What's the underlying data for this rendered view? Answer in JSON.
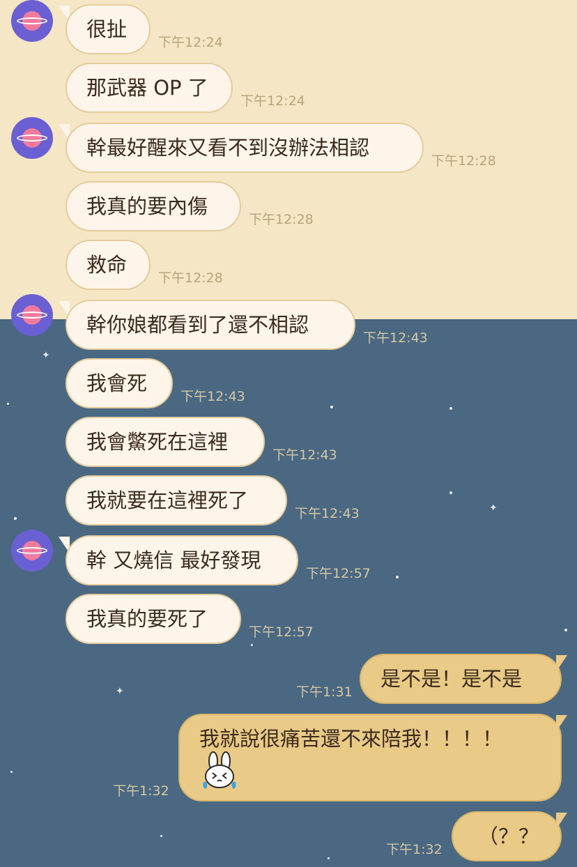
{
  "theme": {
    "top_background": "#f5e6c5",
    "bottom_background": "#4a6882",
    "incoming_bubble": "#fdf5ea",
    "outgoing_bubble": "#e9ca86"
  },
  "messages": [
    {
      "text": "很扯",
      "time": "下午12:24",
      "side": "left",
      "avatar": true
    },
    {
      "text": "那武器 OP 了",
      "time": "下午12:24",
      "side": "left",
      "avatar": false
    },
    {
      "text": "幹最好醒來又看不到沒辦法相認",
      "time": "下午12:28",
      "side": "left",
      "avatar": true
    },
    {
      "text": "我真的要內傷",
      "time": "下午12:28",
      "side": "left",
      "avatar": false
    },
    {
      "text": "救命",
      "time": "下午12:28",
      "side": "left",
      "avatar": false
    },
    {
      "text": "幹你娘都看到了還不相認",
      "time": "下午12:43",
      "side": "left",
      "avatar": true
    },
    {
      "text": "我會死",
      "time": "下午12:43",
      "side": "left",
      "avatar": false
    },
    {
      "text": "我會鱉死在這裡",
      "time": "下午12:43",
      "side": "left",
      "avatar": false
    },
    {
      "text": "我就要在這裡死了",
      "time": "下午12:43",
      "side": "left",
      "avatar": false
    },
    {
      "text": "幹 又燒信 最好發現",
      "time": "下午12:57",
      "side": "left",
      "avatar": true
    },
    {
      "text": "我真的要死了",
      "time": "下午12:57",
      "side": "left",
      "avatar": false
    },
    {
      "text": "是不是！是不是",
      "time": "下午1:31",
      "side": "right"
    },
    {
      "text": "我就說很痛苦還不來陪我！！！！",
      "time": "下午1:32",
      "side": "right",
      "sticker": "crying-bunny-icon"
    },
    {
      "text": "（？？",
      "time": "下午1:32",
      "side": "right"
    }
  ]
}
